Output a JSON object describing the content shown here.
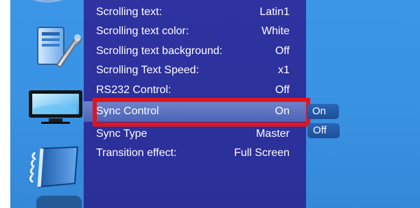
{
  "theme": {
    "background_blue": "#3a93e4",
    "menu_purple": "#2f33a0",
    "selected_row": "#5d72c2",
    "highlight_red": "#e3141b",
    "submenu_blue": "#2361aa",
    "text": "#ffffff"
  },
  "sidebar": {
    "icons": [
      {
        "name": "settings-icon"
      },
      {
        "name": "tools-icon"
      },
      {
        "name": "monitor-icon"
      },
      {
        "name": "manual-icon"
      },
      {
        "name": "partial-icon"
      }
    ]
  },
  "menu": {
    "items": [
      {
        "label": "Scrolling text:",
        "value": "Latin1"
      },
      {
        "label": "Scrolling text color:",
        "value": "White"
      },
      {
        "label": "Scrolling text background:",
        "value": "Off"
      },
      {
        "label": "Scrolling Text Speed:",
        "value": "x1"
      },
      {
        "label": "RS232 Control:",
        "value": "Off"
      },
      {
        "label": "Sync Control",
        "value": "On",
        "selected": true
      },
      {
        "label": "Sync Type",
        "value": "Master"
      },
      {
        "label": "Transition effect:",
        "value": "Full Screen"
      }
    ]
  },
  "submenu": {
    "options": [
      {
        "label": "On"
      },
      {
        "label": "Off"
      }
    ]
  }
}
